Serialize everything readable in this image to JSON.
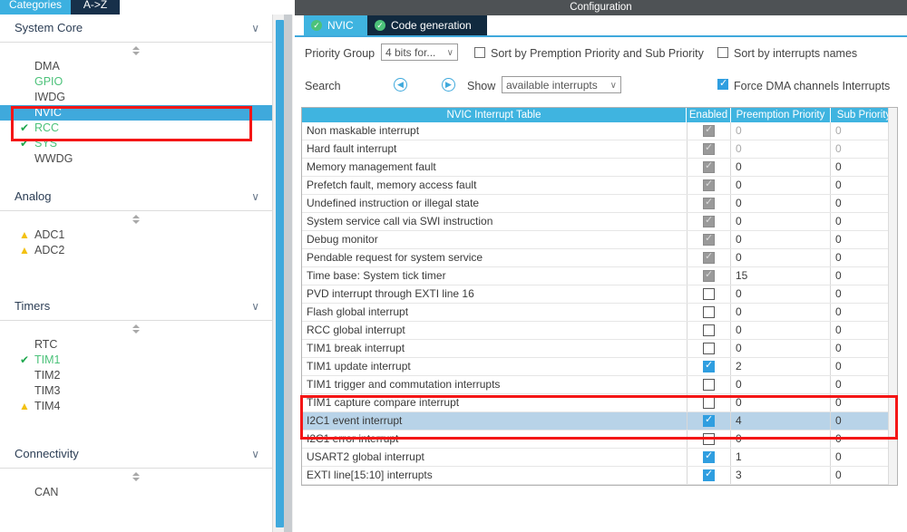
{
  "left_panel": {
    "tabs": [
      {
        "label": "Categories",
        "active": true
      },
      {
        "label": "A->Z",
        "active": false
      }
    ],
    "sections": [
      {
        "title": "System Core",
        "items": [
          {
            "label": "DMA",
            "state": "none"
          },
          {
            "label": "GPIO",
            "state": "ok-text"
          },
          {
            "label": "IWDG",
            "state": "none"
          },
          {
            "label": "NVIC",
            "state": "selected"
          },
          {
            "label": "RCC",
            "state": "ok"
          },
          {
            "label": "SYS",
            "state": "ok"
          },
          {
            "label": "WWDG",
            "state": "none"
          }
        ]
      },
      {
        "title": "Analog",
        "items": [
          {
            "label": "ADC1",
            "state": "warn"
          },
          {
            "label": "ADC2",
            "state": "warn"
          }
        ]
      },
      {
        "title": "Timers",
        "items": [
          {
            "label": "RTC",
            "state": "none"
          },
          {
            "label": "TIM1",
            "state": "ok"
          },
          {
            "label": "TIM2",
            "state": "none"
          },
          {
            "label": "TIM3",
            "state": "none"
          },
          {
            "label": "TIM4",
            "state": "warn"
          }
        ]
      },
      {
        "title": "Connectivity",
        "items": [
          {
            "label": "CAN",
            "state": "none"
          }
        ]
      }
    ],
    "icons": {
      "check": "✔",
      "warn": "▲",
      "chevron": "∨"
    }
  },
  "config": {
    "title": "Configuration",
    "tabs": [
      {
        "label": "NVIC",
        "active": true,
        "icon": "check-circle-icon"
      },
      {
        "label": "Code generation",
        "active": false,
        "icon": "check-circle-icon"
      }
    ],
    "toolbar": {
      "priority_group_label": "Priority Group",
      "priority_group_value": "4 bits for...",
      "sort_preemption_label": "Sort by Premption Priority and Sub Priority",
      "sort_preemption_checked": false,
      "sort_names_label": "Sort by interrupts names",
      "sort_names_checked": false,
      "search_label": "Search",
      "search_prev_icon": "chevron-left-circle-icon",
      "search_next_icon": "chevron-right-circle-icon",
      "show_label": "Show",
      "show_value": "available interrupts",
      "force_dma_label": "Force DMA channels Interrupts",
      "force_dma_checked": true,
      "dropdown_arrow": "∨",
      "prev_glyph": "◀",
      "next_glyph": "▶"
    },
    "table": {
      "headers": [
        "NVIC Interrupt Table",
        "Enabled",
        "Preemption Priority",
        "Sub Priority"
      ],
      "rows": [
        {
          "name": "Non maskable interrupt",
          "enabled": "disabled-checked",
          "preemption": "0",
          "sub": "0",
          "dim": true,
          "selected": false
        },
        {
          "name": "Hard fault interrupt",
          "enabled": "disabled-checked",
          "preemption": "0",
          "sub": "0",
          "dim": true,
          "selected": false
        },
        {
          "name": "Memory management fault",
          "enabled": "disabled-checked",
          "preemption": "0",
          "sub": "0",
          "dim": false,
          "selected": false
        },
        {
          "name": "Prefetch fault, memory access fault",
          "enabled": "disabled-checked",
          "preemption": "0",
          "sub": "0",
          "dim": false,
          "selected": false
        },
        {
          "name": "Undefined instruction or illegal state",
          "enabled": "disabled-checked",
          "preemption": "0",
          "sub": "0",
          "dim": false,
          "selected": false
        },
        {
          "name": "System service call via SWI instruction",
          "enabled": "disabled-checked",
          "preemption": "0",
          "sub": "0",
          "dim": false,
          "selected": false
        },
        {
          "name": "Debug monitor",
          "enabled": "disabled-checked",
          "preemption": "0",
          "sub": "0",
          "dim": false,
          "selected": false
        },
        {
          "name": "Pendable request for system service",
          "enabled": "disabled-checked",
          "preemption": "0",
          "sub": "0",
          "dim": false,
          "selected": false
        },
        {
          "name": "Time base: System tick timer",
          "enabled": "disabled-checked",
          "preemption": "15",
          "sub": "0",
          "dim": false,
          "selected": false
        },
        {
          "name": "PVD interrupt through EXTI line 16",
          "enabled": "unchecked",
          "preemption": "0",
          "sub": "0",
          "dim": false,
          "selected": false
        },
        {
          "name": "Flash global interrupt",
          "enabled": "unchecked",
          "preemption": "0",
          "sub": "0",
          "dim": false,
          "selected": false
        },
        {
          "name": "RCC global interrupt",
          "enabled": "unchecked",
          "preemption": "0",
          "sub": "0",
          "dim": false,
          "selected": false
        },
        {
          "name": "TIM1 break interrupt",
          "enabled": "unchecked",
          "preemption": "0",
          "sub": "0",
          "dim": false,
          "selected": false
        },
        {
          "name": "TIM1 update interrupt",
          "enabled": "checked",
          "preemption": "2",
          "sub": "0",
          "dim": false,
          "selected": false
        },
        {
          "name": "TIM1 trigger and commutation interrupts",
          "enabled": "unchecked",
          "preemption": "0",
          "sub": "0",
          "dim": false,
          "selected": false
        },
        {
          "name": "TIM1 capture compare interrupt",
          "enabled": "unchecked",
          "preemption": "0",
          "sub": "0",
          "dim": false,
          "selected": false
        },
        {
          "name": "I2C1 event interrupt",
          "enabled": "checked",
          "preemption": "4",
          "sub": "0",
          "dim": false,
          "selected": true
        },
        {
          "name": "I2C1 error interrupt",
          "enabled": "unchecked",
          "preemption": "0",
          "sub": "0",
          "dim": false,
          "selected": false
        },
        {
          "name": "USART2 global interrupt",
          "enabled": "checked",
          "preemption": "1",
          "sub": "0",
          "dim": false,
          "selected": false
        },
        {
          "name": "EXTI line[15:10] interrupts",
          "enabled": "checked",
          "preemption": "3",
          "sub": "0",
          "dim": false,
          "selected": false
        }
      ]
    }
  },
  "annotations": {
    "accent_red": "#f41616",
    "accent_blue": "#3fa9dc",
    "header_blue": "#3fb4e0",
    "title_grey": "#4e5255",
    "selection_blue": "#b8d3e8",
    "boxes": [
      {
        "name": "sidebar-nvic-rcc-highlight"
      },
      {
        "name": "table-i2c1-rows-highlight"
      }
    ]
  }
}
